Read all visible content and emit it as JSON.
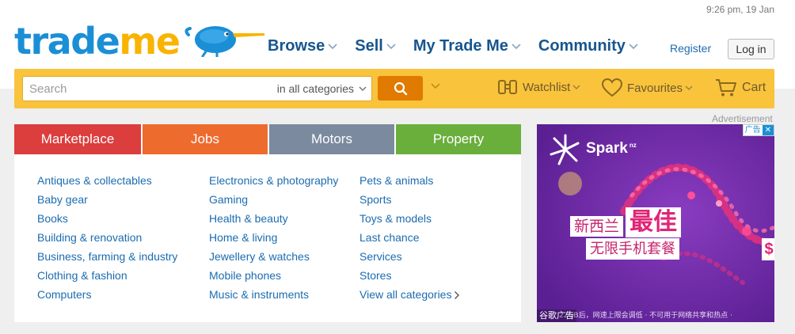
{
  "header": {
    "datetime": "9:26 pm, 19 Jan",
    "logo": {
      "part1": "trade",
      "part2": "me",
      "icon": "kiwi-bird-icon"
    },
    "nav": [
      {
        "label": "Browse",
        "icon": "chevron-down-icon"
      },
      {
        "label": "Sell",
        "icon": "chevron-down-icon"
      },
      {
        "label": "My Trade Me",
        "icon": "chevron-down-icon"
      },
      {
        "label": "Community",
        "icon": "chevron-down-icon"
      }
    ],
    "register_label": "Register",
    "login_label": "Log in"
  },
  "search": {
    "placeholder": "Search",
    "value": "",
    "category_selected": "in all categories",
    "button_icon": "search-icon"
  },
  "utilities": {
    "watchlist": {
      "label": "Watchlist",
      "icon": "binoculars-icon"
    },
    "favourites": {
      "label": "Favourites",
      "icon": "heart-icon"
    },
    "cart": {
      "label": "Cart",
      "icon": "cart-icon"
    }
  },
  "tabs": [
    {
      "label": "Marketplace",
      "color": "#dc3d3d"
    },
    {
      "label": "Jobs",
      "color": "#ee6b2e"
    },
    {
      "label": "Motors",
      "color": "#7b8a9e"
    },
    {
      "label": "Property",
      "color": "#6aae3c"
    }
  ],
  "categories": {
    "column1": [
      "Antiques & collectables",
      "Baby gear",
      "Books",
      "Building & renovation",
      "Business, farming & industry",
      "Clothing & fashion",
      "Computers"
    ],
    "column2": [
      "Electronics & photography",
      "Gaming",
      "Health & beauty",
      "Home & living",
      "Jewellery & watches",
      "Mobile phones",
      "Music & instruments"
    ],
    "column3": [
      "Pets & animals",
      "Sports",
      "Toys & models",
      "Last chance",
      "Services",
      "Stores",
      "View all categories"
    ]
  },
  "advertisement": {
    "label": "Advertisement",
    "brand": "Spark",
    "brand_sup": "nz",
    "headline_part1": "新西兰",
    "headline_part2": "最佳",
    "headline_line2": "无限手机套餐",
    "price_glyph": "$",
    "fine_print": "22GB后，网速上限会调低 · 不可用于网络共享和热点 ·",
    "corner_label": "谷歌广告",
    "badge_text": "广告",
    "badge_close": "✕",
    "colors": {
      "background": "#6e2ca6",
      "accent": "#e02477"
    }
  },
  "colors": {
    "brand_blue": "#1b8fd6",
    "brand_yellow": "#f8b400",
    "search_bar": "#f9c33c",
    "search_button": "#e07a00",
    "link": "#1b6cb0",
    "nav": "#17568e"
  }
}
